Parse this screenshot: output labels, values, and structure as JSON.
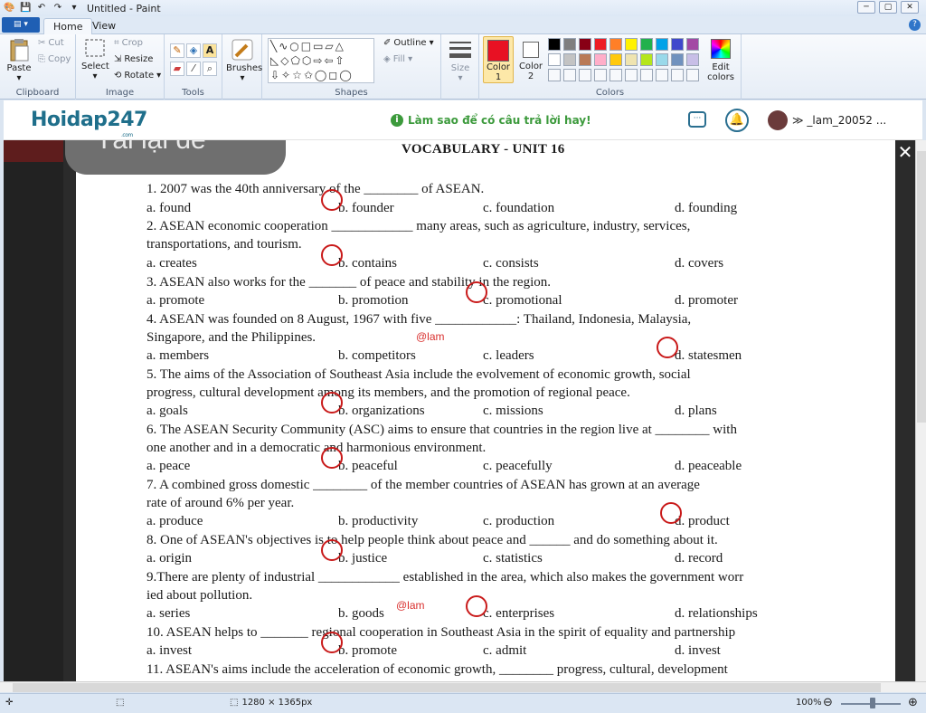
{
  "window": {
    "title": "Untitled - Paint"
  },
  "tabs": [
    {
      "label": "Home"
    },
    {
      "label": "View"
    }
  ],
  "ribbon": {
    "clipboard": {
      "label": "Clipboard",
      "paste": "Paste",
      "cut": "Cut",
      "copy": "Copy"
    },
    "image": {
      "label": "Image",
      "select": "Select",
      "crop": "Crop",
      "resize": "Resize",
      "rotate": "Rotate"
    },
    "tools": {
      "label": "Tools"
    },
    "brushes": {
      "label": "Brushes"
    },
    "shapes": {
      "label": "Shapes",
      "outline": "Outline",
      "fill": "Fill"
    },
    "size": {
      "label": "Size"
    },
    "colors": {
      "label": "Colors",
      "color1": "Color\n1",
      "color2": "Color\n2",
      "edit": "Edit\ncolors",
      "color1_value": "#e81123",
      "color2_value": "#ffffff",
      "palette": [
        "#000000",
        "#7f7f7f",
        "#880015",
        "#ed1c24",
        "#ff7f27",
        "#fff200",
        "#22b14c",
        "#00a2e8",
        "#3f48cc",
        "#a349a4",
        "#ffffff",
        "#c3c3c3",
        "#b97a57",
        "#ffaec9",
        "#ffc90e",
        "#efe4b0",
        "#b5e61d",
        "#99d9ea",
        "#7092be",
        "#c8bfe7"
      ]
    }
  },
  "site": {
    "logo": "Hoidap247",
    "logo_sub": ".com",
    "tip": "Làm sao để có câu trả lời hay!",
    "username": "_lam_20052 ..."
  },
  "overlay": {
    "retake": "Tải lại đề"
  },
  "doc": {
    "title": "VOCABULARY - UNIT 16",
    "watermark": "@lam",
    "questions": [
      {
        "q": "1. 2007 was the 40th anniversary of the ________ of ASEAN.",
        "opts": [
          "a. found",
          "b. founder",
          "c. foundation",
          "d. founding"
        ]
      },
      {
        "q": "2. ASEAN economic cooperation ____________ many areas, such as agriculture, industry, services,",
        "q2": "transportations, and tourism.",
        "opts": [
          "a. creates",
          "b. contains",
          "c. consists",
          "d. covers"
        ]
      },
      {
        "q": "3. ASEAN also works for the _______ of peace and stability in the region.",
        "opts": [
          "a. promote",
          "b. promotion",
          "c. promotional",
          "d. promoter"
        ]
      },
      {
        "q": "4. ASEAN was founded on 8 August, 1967 with five ____________: Thailand, Indonesia, Malaysia,",
        "q2": "Singapore, and the Philippines.",
        "opts": [
          "a. members",
          "b. competitors",
          "c. leaders",
          "d. statesmen"
        ]
      },
      {
        "q": "5. The aims of the Association of Southeast Asia include the evolvement of economic growth, social",
        "q2": "progress, cultural development among its members, and the promotion of regional peace.",
        "opts": [
          "a. goals",
          "b. organizations",
          "c. missions",
          "d. plans"
        ]
      },
      {
        "q": "6. The ASEAN Security Community (ASC) aims to ensure that countries in the region live at ________ with",
        "q2": "one another and in a democratic and harmonious environment.",
        "opts": [
          "a. peace",
          "b. peaceful",
          "c. peacefully",
          "d. peaceable"
        ]
      },
      {
        "q": "7. A combined gross domestic ________ of the member countries of ASEAN has grown at an average",
        "q2": "rate of around 6% per year.",
        "opts": [
          "a. produce",
          "b. productivity",
          "c. production",
          "d. product"
        ]
      },
      {
        "q": "8. One of ASEAN's objectives is to help people think about peace and ______ and do something about it.",
        "opts": [
          "a. origin",
          "b. justice",
          "c. statistics",
          "d. record"
        ]
      },
      {
        "q": "9.There are plenty of industrial ____________ established in the area, which also makes the government worr",
        "q2": "ied about pollution.",
        "opts": [
          "a. series",
          "b. goods",
          "c. enterprises",
          "d. relationships"
        ]
      },
      {
        "q": "10. ASEAN helps to _______ regional cooperation in Southeast Asia in the spirit of equality and partnership",
        "opts": [
          "a. invest",
          "b. promote",
          "c. admit",
          "d. invest"
        ]
      },
      {
        "q": "11. ASEAN's aims include the acceleration of economic growth, ________ progress, cultural, development"
      }
    ]
  },
  "status": {
    "dimensions": "1280 × 1365px",
    "zoom": "100%"
  }
}
